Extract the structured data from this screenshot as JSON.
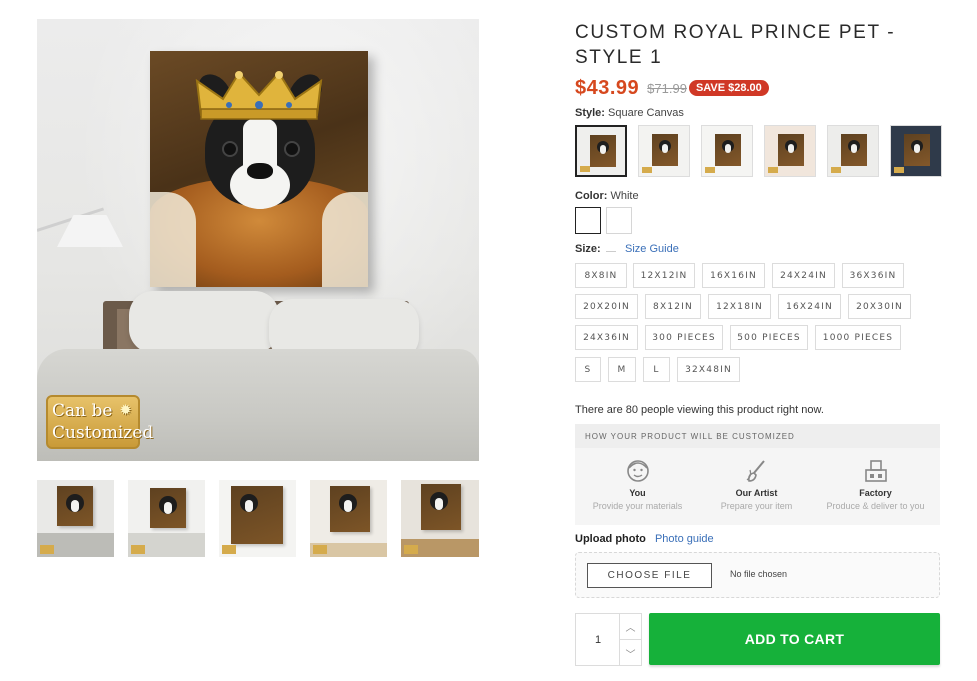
{
  "product": {
    "title": "CUSTOM ROYAL PRINCE PET - STYLE 1",
    "price": "$43.99",
    "compare_price": "$71.99",
    "save_badge": "SAVE $28.00"
  },
  "gallery": {
    "badge_line1": "Can be",
    "badge_line2": "Customized",
    "thumbnail_count": 5
  },
  "style_option": {
    "label": "Style:",
    "value": "Square Canvas",
    "swatch_count": 6
  },
  "color_option": {
    "label": "Color:",
    "value": "White",
    "swatch_count": 2
  },
  "size_option": {
    "label": "Size:",
    "guide_link": "Size Guide",
    "sizes": [
      "8X8IN",
      "12X12IN",
      "16X16IN",
      "24X24IN",
      "36X36IN",
      "20X20IN",
      "8X12IN",
      "12X18IN",
      "16X24IN",
      "20X30IN",
      "24X36IN",
      "300 PIECES",
      "500 PIECES",
      "1000 PIECES",
      "S",
      "M",
      "L",
      "32X48IN"
    ]
  },
  "viewing_text": "There are 80 people viewing this product right now.",
  "customization": {
    "header": "HOW YOUR PRODUCT WILL BE CUSTOMIZED",
    "steps": [
      {
        "title": "You",
        "subtitle": "Provide your materials",
        "icon": "person-icon"
      },
      {
        "title": "Our Artist",
        "subtitle": "Prepare your item",
        "icon": "paintbrush-icon"
      },
      {
        "title": "Factory",
        "subtitle": "Produce & deliver to you",
        "icon": "factory-icon"
      }
    ]
  },
  "upload": {
    "label": "Upload photo",
    "guide_link": "Photo guide",
    "button": "CHOOSE FILE",
    "status": "No file chosen"
  },
  "cart": {
    "quantity": "1",
    "add_button": "ADD TO CART"
  },
  "colors": {
    "price": "#d6481e",
    "save_badge": "#d03826",
    "link": "#3a6fb8",
    "add_to_cart": "#16b13a"
  }
}
